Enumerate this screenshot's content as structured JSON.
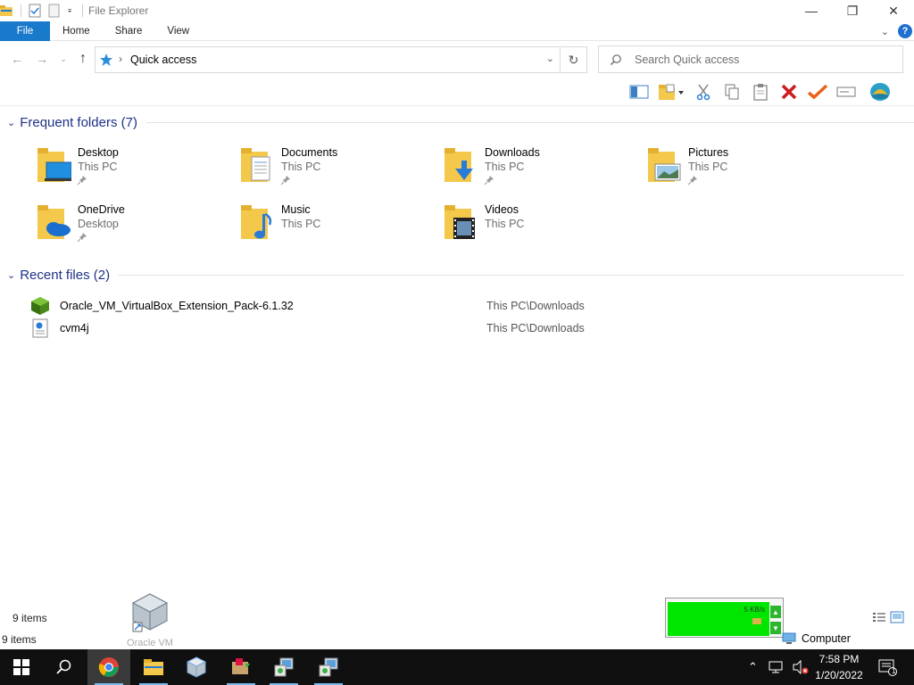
{
  "window": {
    "title": "File Explorer",
    "controls": {
      "minimize": "—",
      "maximize": "❐",
      "close": "✕"
    }
  },
  "ribbon": {
    "tabs": [
      {
        "label": "File"
      },
      {
        "label": "Home"
      },
      {
        "label": "Share"
      },
      {
        "label": "View"
      }
    ],
    "help": "?"
  },
  "address": {
    "path": "Quick access",
    "search_placeholder": "Search Quick access"
  },
  "groups": {
    "frequent": {
      "title": "Frequent folders (7)",
      "items": [
        {
          "name": "Desktop",
          "location": "This PC",
          "icon": "desktop-folder-icon"
        },
        {
          "name": "Documents",
          "location": "This PC",
          "icon": "documents-folder-icon"
        },
        {
          "name": "Downloads",
          "location": "This PC",
          "icon": "downloads-folder-icon"
        },
        {
          "name": "Pictures",
          "location": "This PC",
          "icon": "pictures-folder-icon"
        },
        {
          "name": "OneDrive",
          "location": "Desktop",
          "icon": "onedrive-folder-icon"
        },
        {
          "name": "Music",
          "location": "This PC",
          "icon": "music-folder-icon"
        },
        {
          "name": "Videos",
          "location": "This PC",
          "icon": "videos-folder-icon"
        }
      ]
    },
    "recent": {
      "title": "Recent files (2)",
      "items": [
        {
          "name": "Oracle_VM_VirtualBox_Extension_Pack-6.1.32",
          "path": "This PC\\Downloads",
          "icon": "virtualbox-cube-icon"
        },
        {
          "name": "cvm4j",
          "path": "This PC\\Downloads",
          "icon": "document-file-icon"
        }
      ]
    }
  },
  "status": {
    "items_top": "9 items",
    "items_bottom": "9 items",
    "computer": "Computer"
  },
  "desktop_icon": {
    "label": "Oracle VM"
  },
  "netmeter": {
    "rate": "5 KB/s"
  },
  "taskbar": {
    "time": "7:58 PM",
    "date": "1/20/2022",
    "notification_count": "1"
  },
  "colors": {
    "file_tab": "#1979ca",
    "group_header": "#1e3287",
    "taskbar": "#101010",
    "netmeter": "#00e600",
    "folder": "#f3c84b"
  }
}
